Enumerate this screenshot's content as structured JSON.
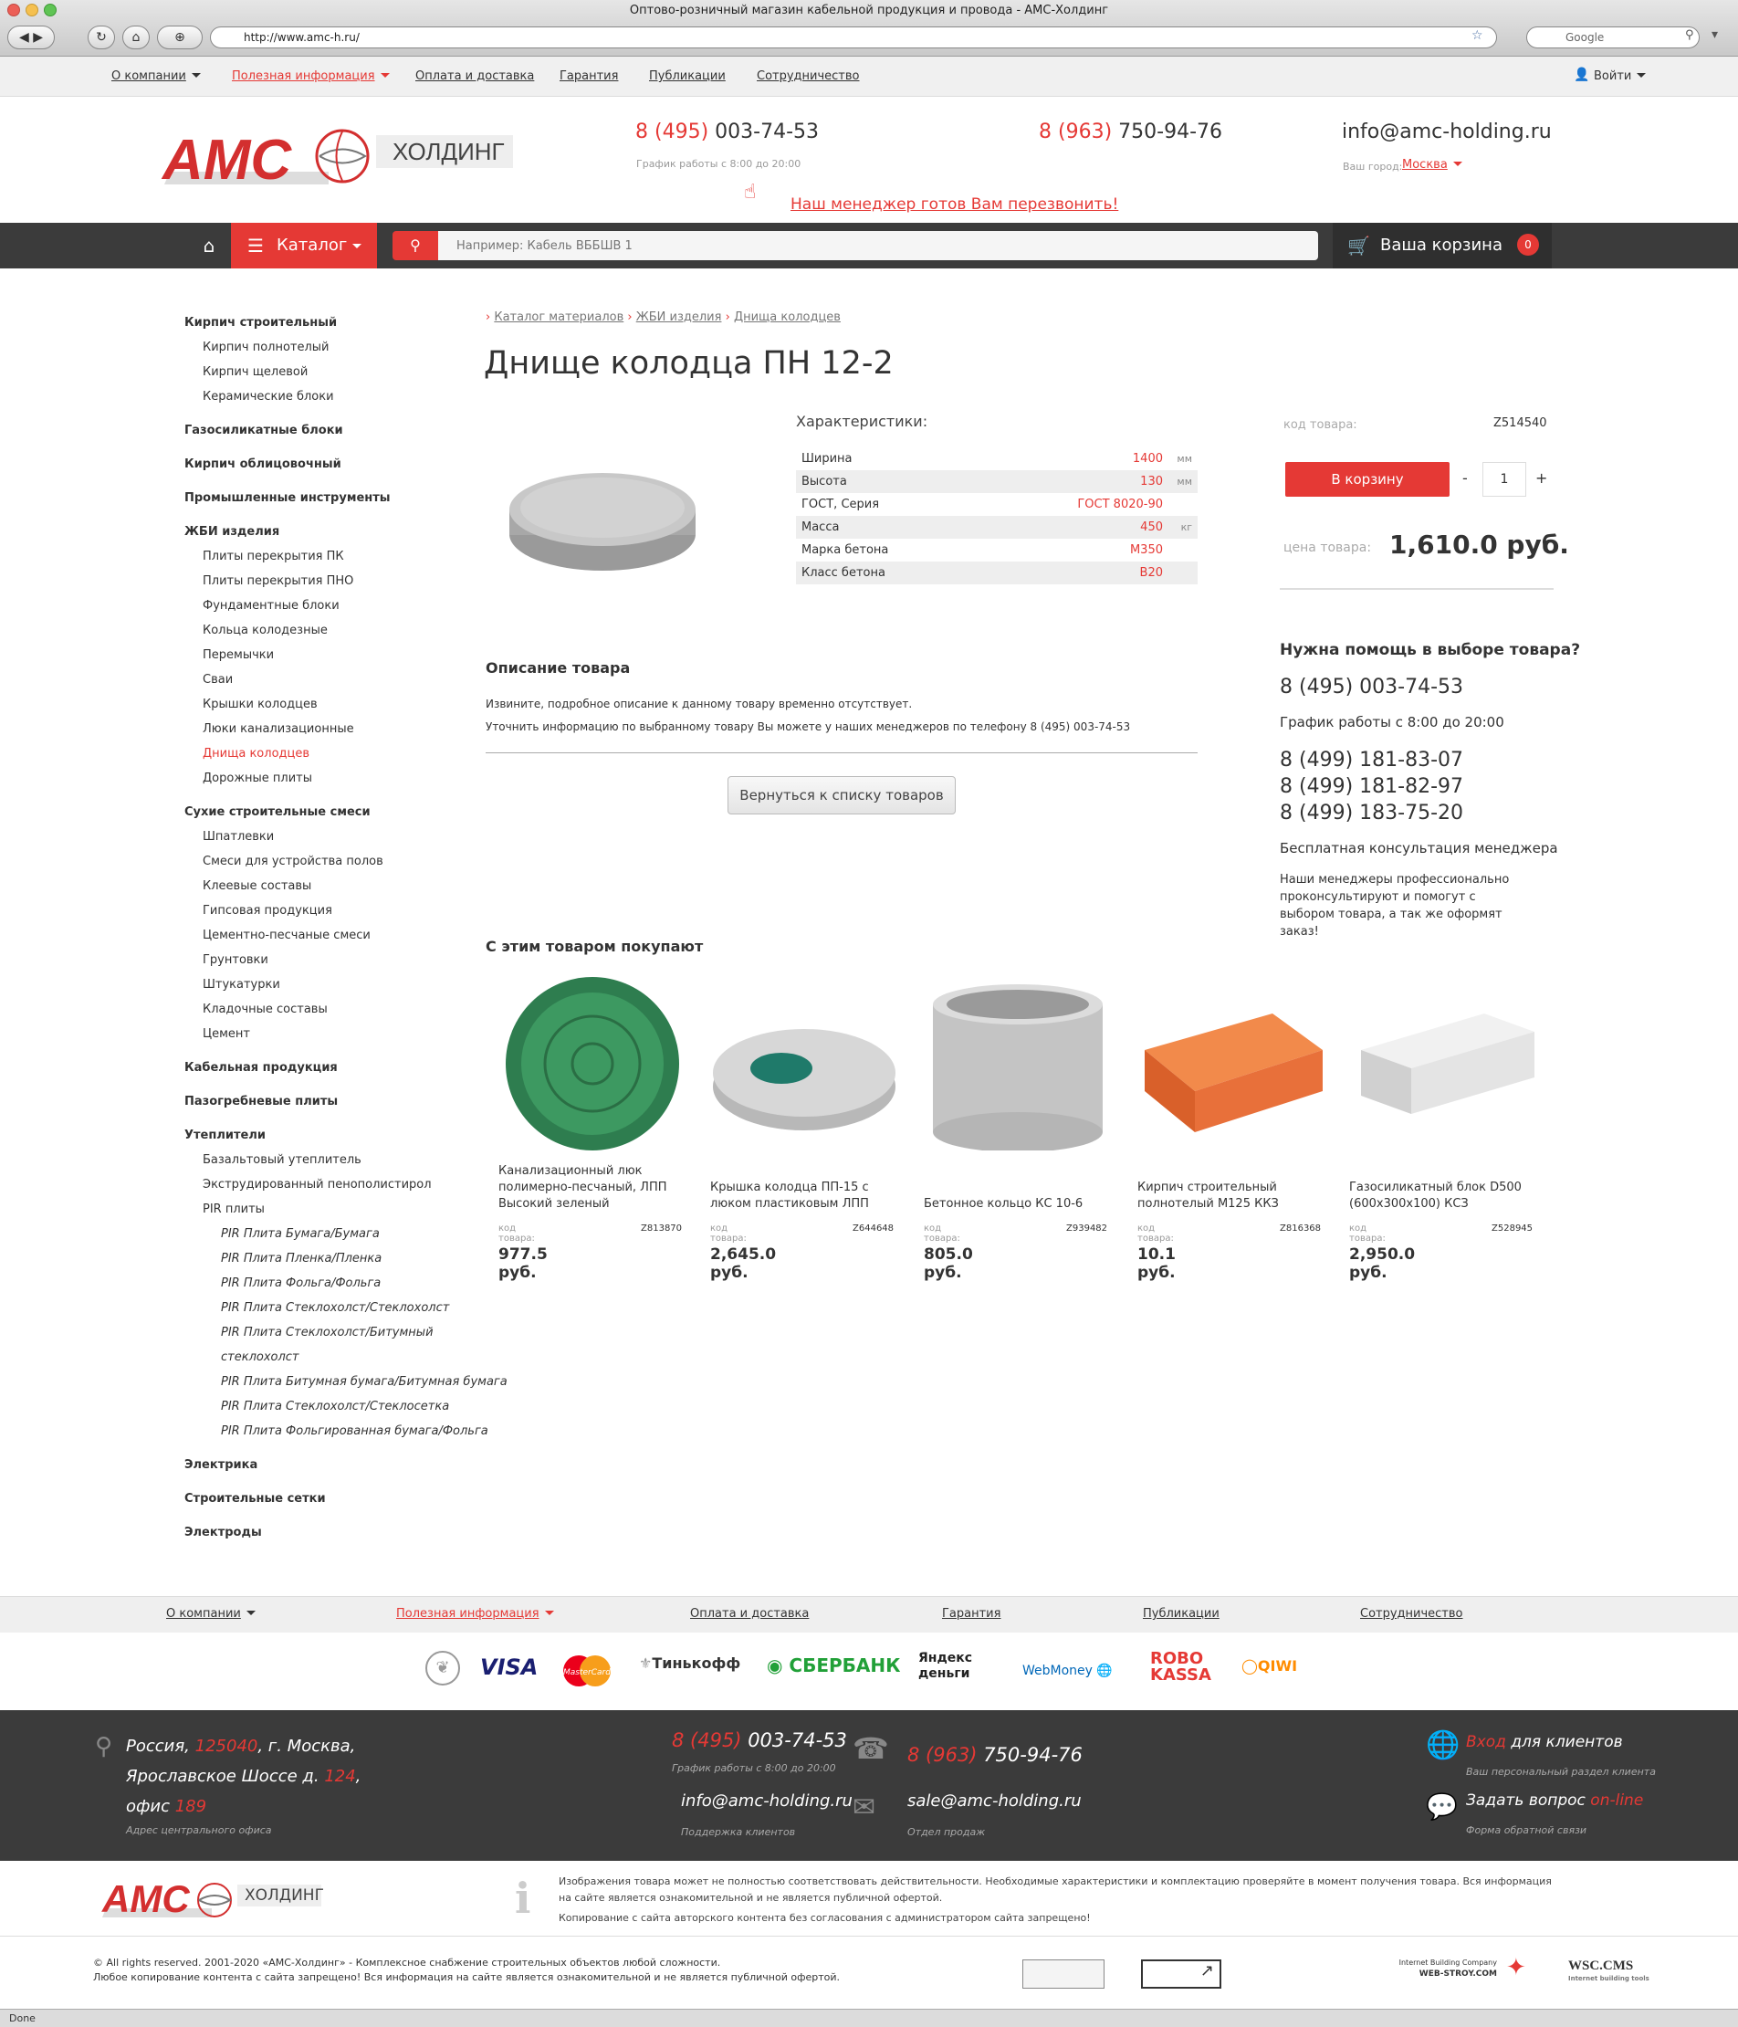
{
  "browser": {
    "title": "Оптово-розничный магазин кабельной продукция и провода - АМС-Холдинг",
    "url": "http://www.amc-h.ru/",
    "search_placeholder": "Google",
    "status": "Done"
  },
  "topnav": {
    "items": [
      "О компании",
      "Полезная информация",
      "Оплата и доставка",
      "Гарантия",
      "Публикации",
      "Сотрудничество"
    ],
    "login": "Войти"
  },
  "header": {
    "logo_main": "АМС",
    "logo_sub": "ХОЛДИНГ",
    "phone1_prefix": "8 (495)",
    "phone1": " 003-74-53",
    "hours": "График работы с 8:00 до 20:00",
    "phone2_prefix": "8 (963)",
    "phone2": " 750-94-76",
    "email": "info@amc-holding.ru",
    "city_label": "Ваш город:",
    "city": "Москва",
    "callback": "Наш менеджер готов Вам перезвонить!"
  },
  "bar": {
    "catalog": "Каталог",
    "search_placeholder": "Например: Кабель ВББШВ 1",
    "cart": "Ваша корзина",
    "cart_count": "0"
  },
  "sidebar": [
    {
      "t": "Кирпич строительный",
      "c": "b"
    },
    {
      "t": "Кирпич полнотелый",
      "c": "s"
    },
    {
      "t": "Кирпич щелевой",
      "c": "s"
    },
    {
      "t": "Керамические блоки",
      "c": "s"
    },
    {
      "t": "Газосиликатные блоки",
      "c": "b"
    },
    {
      "t": "Кирпич облицовочный",
      "c": "b"
    },
    {
      "t": "Промышленные инструменты",
      "c": "b"
    },
    {
      "t": "ЖБИ изделия",
      "c": "b"
    },
    {
      "t": "Плиты перекрытия ПК",
      "c": "s"
    },
    {
      "t": "Плиты перекрытия ПНО",
      "c": "s"
    },
    {
      "t": "Фундаментные блоки",
      "c": "s"
    },
    {
      "t": "Кольца колодезные",
      "c": "s"
    },
    {
      "t": "Перемычки",
      "c": "s"
    },
    {
      "t": "Сваи",
      "c": "s"
    },
    {
      "t": "Крышки колодцев",
      "c": "s"
    },
    {
      "t": "Люки канализационные",
      "c": "s"
    },
    {
      "t": "Днища колодцев",
      "c": "r"
    },
    {
      "t": "Дорожные плиты",
      "c": "s"
    },
    {
      "t": "Сухие строительные смеси",
      "c": "b"
    },
    {
      "t": "Шпатлевки",
      "c": "s"
    },
    {
      "t": "Смеси для устройства полов",
      "c": "s"
    },
    {
      "t": "Клеевые составы",
      "c": "s"
    },
    {
      "t": "Гипсовая продукция",
      "c": "s"
    },
    {
      "t": "Цементно-песчаные смеси",
      "c": "s"
    },
    {
      "t": "Грунтовки",
      "c": "s"
    },
    {
      "t": "Штукатурки",
      "c": "s"
    },
    {
      "t": "Кладочные составы",
      "c": "s"
    },
    {
      "t": "Цемент",
      "c": "s"
    },
    {
      "t": "Кабельная продукция",
      "c": "b"
    },
    {
      "t": "Пазогребневые плиты",
      "c": "b"
    },
    {
      "t": "Утеплители",
      "c": "b"
    },
    {
      "t": "Базальтовый утеплитель",
      "c": "s"
    },
    {
      "t": "Экструдированный пенополистирол",
      "c": "s"
    },
    {
      "t": "PIR плиты",
      "c": "s"
    },
    {
      "t": "PIR Плита Бумага/Бумага",
      "c": "i"
    },
    {
      "t": "PIR Плита Пленка/Пленка",
      "c": "i"
    },
    {
      "t": "PIR Плита Фольга/Фольга",
      "c": "i"
    },
    {
      "t": "PIR Плита Стеклохолст/Стеклохолст",
      "c": "i"
    },
    {
      "t": "PIR Плита Стеклохолст/Битумный",
      "c": "i"
    },
    {
      "t": "стеклохолст",
      "c": "i"
    },
    {
      "t": "PIR Плита Битумная бумага/Битумная бумага",
      "c": "i"
    },
    {
      "t": "PIR Плита Стеклохолст/Стеклосетка",
      "c": "i"
    },
    {
      "t": "PIR Плита Фольгированная бумага/Фольга",
      "c": "i"
    },
    {
      "t": "Электрика",
      "c": "b"
    },
    {
      "t": "Строительные сетки",
      "c": "b"
    },
    {
      "t": "Электроды",
      "c": "b"
    }
  ],
  "breadcrumb": [
    "Каталог материалов",
    "ЖБИ изделия",
    "Днища колодцев"
  ],
  "product": {
    "title": "Днище колодца ПН 12-2",
    "specs_title": "Характеристики:",
    "specs": [
      {
        "k": "Ширина",
        "v": "1400",
        "u": "мм"
      },
      {
        "k": "Высота",
        "v": "130",
        "u": "мм"
      },
      {
        "k": "ГОСТ, Серия",
        "v": "ГОСТ 8020-90",
        "u": ""
      },
      {
        "k": "Масса",
        "v": "450",
        "u": "кг"
      },
      {
        "k": "Марка бетона",
        "v": "М350",
        "u": ""
      },
      {
        "k": "Класс бетона",
        "v": "В20",
        "u": ""
      }
    ],
    "code_label": "код товара:",
    "code": "Z514540",
    "cart_btn": "В корзину",
    "minus": "-",
    "qty": "1",
    "plus": "+",
    "price_label": "цена товара:",
    "price": "1,610.0 руб.",
    "desc_title": "Описание товара",
    "desc1": "Извините, подробное описание к данному товару временно отсутствует.",
    "desc2": "Уточнить информацию по выбранному товару Вы можете у наших менеджеров по телефону 8 (495) 003-74-53",
    "back": "Вернуться к списку товаров"
  },
  "help": {
    "title": "Нужна помощь в выборе товара?",
    "phone": "8 (495) 003-74-53",
    "hours": "График работы с 8:00 до 20:00",
    "phones": [
      "8 (499) 181-83-07",
      "8 (499) 181-82-97",
      "8 (499) 183-75-20"
    ],
    "free": "Бесплатная консультация менеджера",
    "text": "Наши менеджеры профессионально проконсультируют и помогут с выбором товара, а так же оформят заказ!"
  },
  "related": {
    "title": "С этим товаром покупают",
    "code_label": "код товара:",
    "items": [
      {
        "name": "Канализационный люк полимерно-песчаный, ЛПП Высокий зеленый",
        "code": "Z813870",
        "price": "977.5 руб."
      },
      {
        "name": "Крышка колодца ПП-15 с люком пластиковым ЛПП",
        "code": "Z644648",
        "price": "2,645.0 руб."
      },
      {
        "name": "Бетонное кольцо КС 10-6",
        "code": "Z939482",
        "price": "805.0 руб."
      },
      {
        "name": "Кирпич строительный полнотелый М125 ККЗ",
        "code": "Z816368",
        "price": "10.1 руб."
      },
      {
        "name": "Газосиликатный блок D500 (600x300x100) КСЗ",
        "code": "Z528945",
        "price": "2,950.0 руб."
      }
    ]
  },
  "footer": {
    "nav": [
      "О компании",
      "Полезная информация",
      "Оплата и доставка",
      "Гарантия",
      "Публикации",
      "Сотрудничество"
    ],
    "payments": [
      "VISA",
      "MasterCard",
      "Тинькофф",
      "СБЕРБАНК",
      "Яндекс деньги",
      "WebMoney",
      "ROBO KASSA",
      "QIWI"
    ],
    "addr1a": "Россия, ",
    "addr1b": "125040",
    "addr1c": ", г. Москва,",
    "addr2a": "Ярославское Шоссе д. ",
    "addr2b": "124",
    ",": ",",
    "addr3a": "офис ",
    "addr3b": "189",
    "addr_sub": "Адрес центрального офиса",
    "phone1_prefix": "8 (495)",
    "phone1": " 003-74-53",
    "hours": "График работы с 8:00 до 20:00",
    "email1a": "info",
    "email1b": "@amc-holding.ru",
    "email1_sub": "Поддержка клиентов",
    "phone2_prefix": "8 (963)",
    "phone2": " 750-94-76",
    "email2a": "sale",
    "email2b": "@amc-holding.ru",
    "email2_sub": "Отдел продаж",
    "login_a": "Вход",
    "login_b": " для клиентов",
    "login_sub": "Ваш персональный раздел клиента",
    "ask_a": "Задать вопрос ",
    "ask_b": "on-line",
    "ask_sub": "Форма обратной связи",
    "disclaimer1": "Изображения товара может не полностью соответствовать действительности. Необходимые характеристики и комплектацию проверяйте в момент получения товара. Вся информация на сайте является ознакомительной и не является публичной офертой.",
    "disclaimer2": "Копирование с сайта авторского контента без согласования с администратором сайта запрещено!",
    "copy1": "© All rights reserved. 2001-2020 «АМС-Холдинг» - Комплексное снабжение строительных объектов любой сложности.",
    "copy2": "Любое копирование контента с сайта запрещено! Вся информация на сайте является ознакомительной и не является публичной офертой.",
    "studio": "Internet Building Company",
    "studio2": "WEB-STROY.COM",
    "cms": "WSC.CMS",
    "cms_sub": "Internet building tools"
  }
}
